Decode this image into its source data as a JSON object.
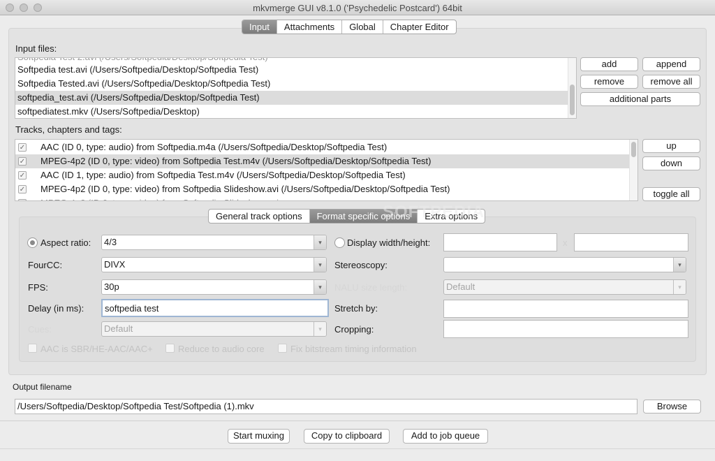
{
  "window": {
    "title": "mkvmerge GUI v8.1.0 ('Psychedelic Postcard') 64bit"
  },
  "main_tabs": [
    {
      "label": "Input",
      "active": true
    },
    {
      "label": "Attachments",
      "active": false
    },
    {
      "label": "Global",
      "active": false
    },
    {
      "label": "Chapter Editor",
      "active": false
    }
  ],
  "input_files": {
    "label": "Input files:",
    "items": [
      "Softpedia test.avi (/Users/Softpedia/Desktop/Softpedia Test)",
      "Softpedia Tested.avi (/Users/Softpedia/Desktop/Softpedia Test)",
      "softpedia_test.avi (/Users/Softpedia/Desktop/Softpedia Test)",
      "softpediatest.mkv (/Users/Softpedia/Desktop)"
    ],
    "selected_index": 2,
    "buttons": {
      "add": "add",
      "append": "append",
      "remove": "remove",
      "remove_all": "remove all",
      "additional_parts": "additional parts"
    }
  },
  "tracks": {
    "label": "Tracks, chapters and tags:",
    "items": [
      {
        "text": "AAC (ID 0, type: audio) from Softpedia.m4a (/Users/Softpedia/Desktop/Softpedia Test)",
        "checked": true
      },
      {
        "text": "MPEG-4p2 (ID 0, type: video) from Softpedia Test.m4v (/Users/Softpedia/Desktop/Softpedia Test)",
        "checked": true
      },
      {
        "text": "AAC (ID 1, type: audio) from Softpedia Test.m4v (/Users/Softpedia/Desktop/Softpedia Test)",
        "checked": true
      },
      {
        "text": "MPEG-4p2 (ID 0, type: video) from Softpedia Slideshow.avi (/Users/Softpedia/Desktop/Softpedia Test)",
        "checked": true
      }
    ],
    "selected_index": 1,
    "buttons": {
      "up": "up",
      "down": "down",
      "toggle_all": "toggle all"
    }
  },
  "option_tabs": [
    {
      "label": "General track options",
      "active": false
    },
    {
      "label": "Format specific options",
      "active": true
    },
    {
      "label": "Extra options",
      "active": false
    }
  ],
  "watermark": "SOFTPEDIA",
  "format_options": {
    "aspect_ratio": {
      "label": "Aspect ratio:",
      "value": "4/3",
      "selected": true
    },
    "display_wh": {
      "label": "Display width/height:",
      "width": "",
      "height": "",
      "separator": "x",
      "selected": false
    },
    "fourcc": {
      "label": "FourCC:",
      "value": "DIVX"
    },
    "stereoscopy": {
      "label": "Stereoscopy:",
      "value": ""
    },
    "fps": {
      "label": "FPS:",
      "value": "30p"
    },
    "nalu": {
      "label": "NALU size length:",
      "value": "Default",
      "disabled": true
    },
    "delay": {
      "label": "Delay (in ms):",
      "value": "softpedia test"
    },
    "stretch": {
      "label": "Stretch by:",
      "value": ""
    },
    "cues": {
      "label": "Cues:",
      "value": "Default",
      "disabled": true
    },
    "cropping": {
      "label": "Cropping:",
      "value": ""
    },
    "checkboxes": [
      {
        "label": "AAC is SBR/HE-AAC/AAC+",
        "checked": false,
        "disabled": true
      },
      {
        "label": "Reduce to audio core",
        "checked": false,
        "disabled": true
      },
      {
        "label": "Fix bitstream timing information",
        "checked": false,
        "disabled": true
      }
    ]
  },
  "output": {
    "label": "Output filename",
    "value": "/Users/Softpedia/Desktop/Softpedia Test/Softpedia (1).mkv",
    "browse": "Browse"
  },
  "actions": {
    "start": "Start muxing",
    "copy": "Copy to clipboard",
    "queue": "Add to job queue"
  },
  "icons": {
    "check": "checkmark-icon",
    "arrow": "chevron-down-icon"
  },
  "colors": {
    "active_tab": "#8a8a8a",
    "selection": "#dcdcdc",
    "window_bg": "#ececec"
  }
}
